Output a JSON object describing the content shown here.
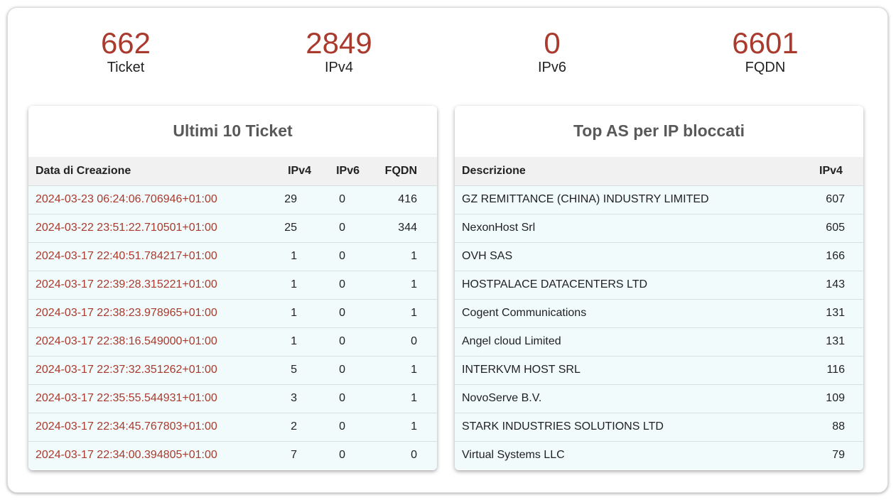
{
  "stats": [
    {
      "value": "662",
      "label": "Ticket"
    },
    {
      "value": "2849",
      "label": "IPv4"
    },
    {
      "value": "0",
      "label": "IPv6"
    },
    {
      "value": "6601",
      "label": "FQDN"
    }
  ],
  "tickets": {
    "title": "Ultimi 10 Ticket",
    "headers": {
      "date": "Data di Creazione",
      "ipv4": "IPv4",
      "ipv6": "IPv6",
      "fqdn": "FQDN"
    },
    "rows": [
      {
        "date": "2024-03-23 06:24:06.706946+01:00",
        "ipv4": "29",
        "ipv6": "0",
        "fqdn": "416"
      },
      {
        "date": "2024-03-22 23:51:22.710501+01:00",
        "ipv4": "25",
        "ipv6": "0",
        "fqdn": "344"
      },
      {
        "date": "2024-03-17 22:40:51.784217+01:00",
        "ipv4": "1",
        "ipv6": "0",
        "fqdn": "1"
      },
      {
        "date": "2024-03-17 22:39:28.315221+01:00",
        "ipv4": "1",
        "ipv6": "0",
        "fqdn": "1"
      },
      {
        "date": "2024-03-17 22:38:23.978965+01:00",
        "ipv4": "1",
        "ipv6": "0",
        "fqdn": "1"
      },
      {
        "date": "2024-03-17 22:38:16.549000+01:00",
        "ipv4": "1",
        "ipv6": "0",
        "fqdn": "0"
      },
      {
        "date": "2024-03-17 22:37:32.351262+01:00",
        "ipv4": "5",
        "ipv6": "0",
        "fqdn": "1"
      },
      {
        "date": "2024-03-17 22:35:55.544931+01:00",
        "ipv4": "3",
        "ipv6": "0",
        "fqdn": "1"
      },
      {
        "date": "2024-03-17 22:34:45.767803+01:00",
        "ipv4": "2",
        "ipv6": "0",
        "fqdn": "1"
      },
      {
        "date": "2024-03-17 22:34:00.394805+01:00",
        "ipv4": "7",
        "ipv6": "0",
        "fqdn": "0"
      }
    ]
  },
  "top_as": {
    "title": "Top AS per IP bloccati",
    "headers": {
      "description": "Descrizione",
      "ipv4": "IPv4"
    },
    "rows": [
      {
        "description": "GZ REMITTANCE (CHINA) INDUSTRY LIMITED",
        "ipv4": "607"
      },
      {
        "description": "NexonHost Srl",
        "ipv4": "605"
      },
      {
        "description": "OVH SAS",
        "ipv4": "166"
      },
      {
        "description": "HOSTPALACE DATACENTERS LTD",
        "ipv4": "143"
      },
      {
        "description": "Cogent Communications",
        "ipv4": "131"
      },
      {
        "description": "Angel cloud Limited",
        "ipv4": "131"
      },
      {
        "description": "INTERKVM HOST SRL",
        "ipv4": "116"
      },
      {
        "description": "NovoServe B.V.",
        "ipv4": "109"
      },
      {
        "description": "STARK INDUSTRIES SOLUTIONS LTD",
        "ipv4": "88"
      },
      {
        "description": "Virtual Systems LLC",
        "ipv4": "79"
      }
    ]
  },
  "colors": {
    "accent": "#a93a2d",
    "row_bg": "#f1fbfc",
    "header_bg": "#f1f1f1"
  }
}
